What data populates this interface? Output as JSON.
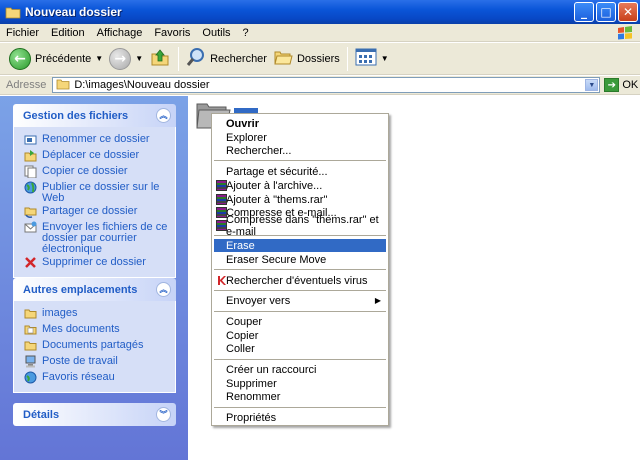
{
  "window": {
    "title": "Nouveau dossier"
  },
  "menubar": {
    "items": [
      "Fichier",
      "Edition",
      "Affichage",
      "Favoris",
      "Outils",
      "?"
    ]
  },
  "toolbar": {
    "back_label": "Précédente",
    "search_label": "Rechercher",
    "folders_label": "Dossiers"
  },
  "address": {
    "label": "Adresse",
    "value": "D:\\images\\Nouveau dossier",
    "go_label": "OK"
  },
  "panel": {
    "file_tasks": {
      "title": "Gestion des fichiers",
      "items": [
        "Renommer ce dossier",
        "Déplacer ce dossier",
        "Copier ce dossier",
        "Publier ce dossier sur le Web",
        "Partager ce dossier",
        "Envoyer les fichiers de ce dossier par courrier électronique",
        "Supprimer ce dossier"
      ]
    },
    "other_places": {
      "title": "Autres emplacements",
      "items": [
        "images",
        "Mes documents",
        "Documents partagés",
        "Poste de travail",
        "Favoris réseau"
      ]
    },
    "details": {
      "title": "Détails"
    }
  },
  "context_menu": {
    "open": "Ouvrir",
    "explore": "Explorer",
    "search": "Rechercher...",
    "share": "Partage et sécurité...",
    "add_archive": "Ajouter à l'archive...",
    "add_rar": "Ajouter à \"thems.rar\"",
    "compress_email": "Compresse et e-mail...",
    "compress_rar_email": "Compresse dans \"thems.rar\" et e-mail",
    "erase": "Erase",
    "eraser_secure_move": "Eraser Secure Move",
    "virus_scan": "Rechercher d'éventuels virus",
    "send_to": "Envoyer vers",
    "cut": "Couper",
    "copy": "Copier",
    "paste": "Coller",
    "shortcut": "Créer un raccourci",
    "delete": "Supprimer",
    "rename": "Renommer",
    "properties": "Propriétés"
  },
  "colors": {
    "titlebar": "#0a55d8",
    "panel_link": "#215dc6",
    "highlight": "#316ac5"
  }
}
